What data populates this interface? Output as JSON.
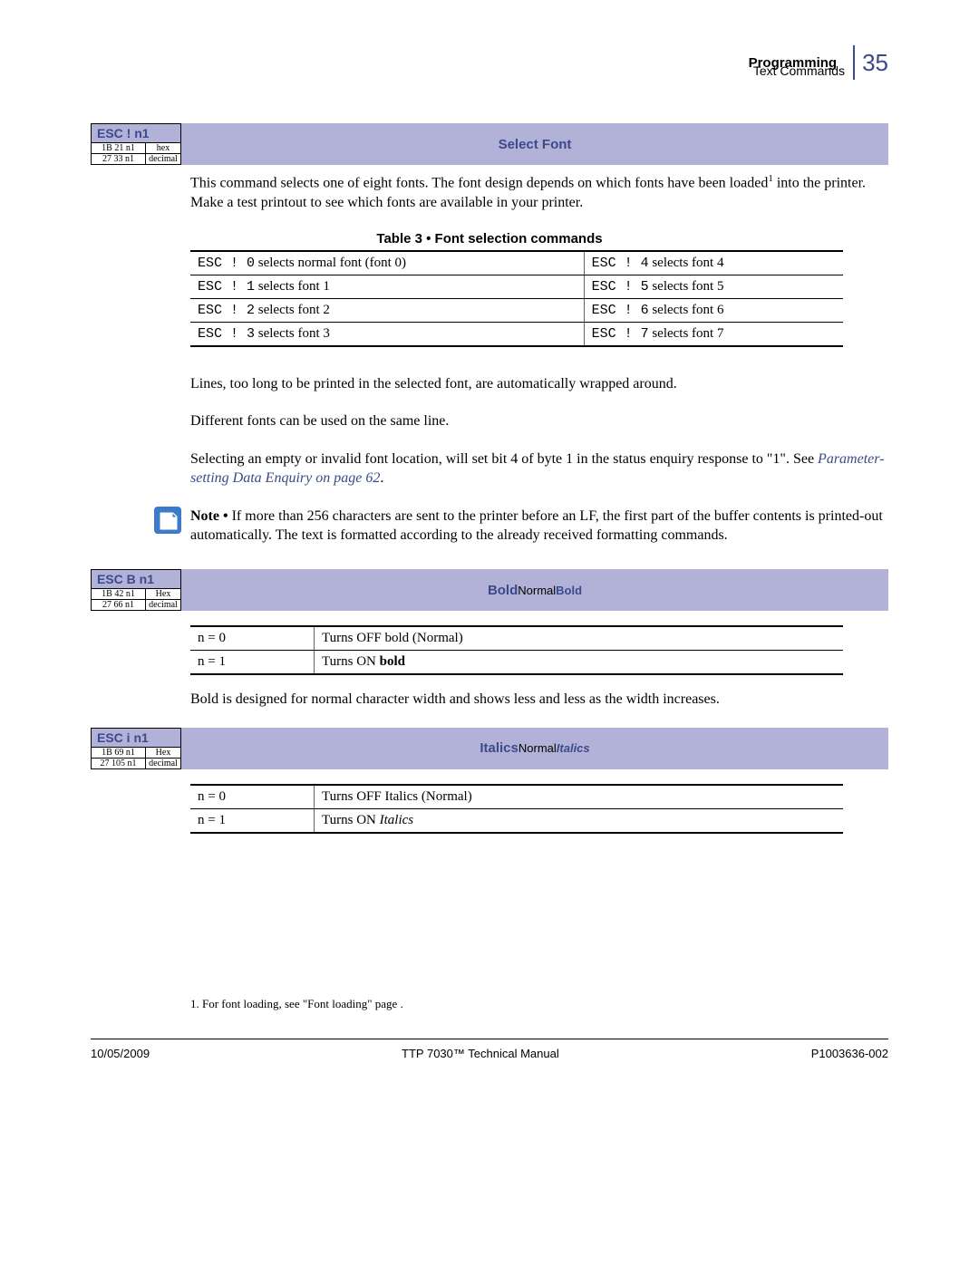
{
  "header": {
    "section": "Programming",
    "subsection": "Text Commands",
    "pagenum": "35"
  },
  "cmd1": {
    "name": "ESC !  n1",
    "hex": "1B 21  n1",
    "hexlabel": "hex",
    "dec": "27 33  n1",
    "declabel": "decimal",
    "title": "Select Font",
    "para1_a": "This command selects one of eight fonts. The font design depends on which fonts have been loaded",
    "para1_b": " into the printer. Make a test printout to see which fonts are available in your printer.",
    "tablecap": "Table 3 • Font selection commands",
    "rows": [
      {
        "l_code": "ESC ! 0",
        "l_txt": " selects normal font (font 0)",
        "r_code": "ESC ! 4",
        "r_txt": " selects font 4"
      },
      {
        "l_code": "ESC ! 1",
        "l_txt": " selects font 1",
        "r_code": "ESC ! 5",
        "r_txt": " selects font 5"
      },
      {
        "l_code": "ESC ! 2",
        "l_txt": " selects font 2",
        "r_code": "ESC ! 6",
        "r_txt": " selects font 6"
      },
      {
        "l_code": "ESC ! 3",
        "l_txt": " selects font 3",
        "r_code": "ESC ! 7",
        "r_txt": " selects font 7"
      }
    ],
    "para2": "Lines, too long to be printed in the selected font, are automatically wrapped around.",
    "para3": "Different fonts can be used on the same line.",
    "para4_a": "Selecting an empty or invalid font location, will set bit 4 of byte 1 in the status enquiry response to \"1\". See ",
    "para4_link": "Parameter-setting Data Enquiry",
    "para4_b": " on page 62",
    "para4_c": ".",
    "note_label": "Note • ",
    "note_text": "If more than 256 characters are sent to the printer before an LF, the first part of the buffer contents is printed-out automatically. The text is formatted according to the already received formatting commands."
  },
  "cmd2": {
    "name": "ESC B  n1",
    "hex": "1B 42  n1",
    "hexlabel": "Hex",
    "dec": "27 66  n1",
    "declabel": "decimal",
    "title_bold1": "Bold",
    "title_norm": "Normal ",
    "title_bold2": "Bold",
    "rows": [
      {
        "k": "n = 0",
        "v": "Turns OFF bold (Normal)"
      },
      {
        "k": "n = 1",
        "v_a": "Turns ON ",
        "v_b": "bold"
      }
    ],
    "para": "Bold is designed for normal character width and shows less and less as the width increases."
  },
  "cmd3": {
    "name": "ESC i  n1",
    "hex": "1B 69  n1",
    "hexlabel": "Hex",
    "dec": "27 105  n1",
    "declabel": "decimal",
    "title_bold": "Italics",
    "title_norm": "Normal ",
    "title_ital": "Italics",
    "rows": [
      {
        "k": "n = 0",
        "v": "Turns OFF Italics (Normal)"
      },
      {
        "k": "n = 1",
        "v_a": "Turns ON ",
        "v_b": "Italics"
      }
    ]
  },
  "footnote": "1. For font loading, see \"Font loading\" page .",
  "footer": {
    "date": "10/05/2009",
    "center": "TTP 7030™ Technical Manual",
    "right": "P1003636-002"
  }
}
